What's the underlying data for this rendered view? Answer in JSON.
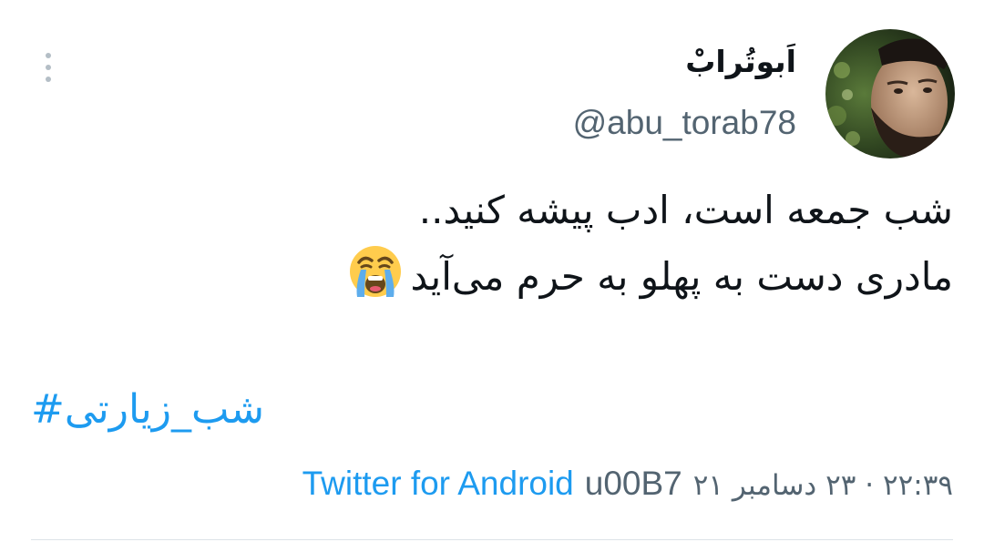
{
  "tweet": {
    "display_name": "اَبوتُرابْ",
    "handle": "@abu_torab78",
    "text_lines": [
      "شب جمعه است، ادب پیشه کنید..",
      "مادری دست به پهلو به حرم می‌آید"
    ],
    "emoji": "loudly-crying-face",
    "hashtag": "#شب_زیارتی",
    "datetime": "۲۲:۳۹ · ۲۳ دسامبر ۲۱",
    "code": "u00B7",
    "client": "Twitter for Android"
  },
  "colors": {
    "link": "#1d9bf0",
    "secondary_text": "#536471",
    "primary_text": "#0f1419",
    "divider": "#dde3e8"
  }
}
